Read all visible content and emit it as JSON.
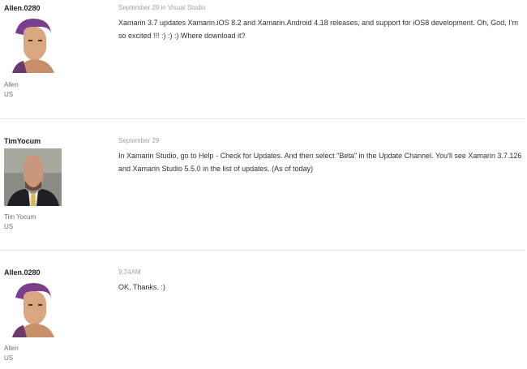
{
  "posts": [
    {
      "username": "Allen.0280",
      "display_name": "Allen",
      "country": "US",
      "date": "September 29",
      "in_word": "in",
      "forum": "Visual Studio",
      "text": "Xamarin 3.7 updates Xamarin.iOS 8.2 and Xamarin.Android 4.18 releases, and support for iOS8 development. Oh, God, I'm so excited !!! :) :) :) Where download it?",
      "avatar_icon": "user-avatar-photo"
    },
    {
      "username": "TimYocum",
      "display_name": "Tim Yocum",
      "country": "US",
      "date": "September 29",
      "text": "In Xamarin Studio, go to Help - Check for Updates. And then select \"Beta\" in the Update Channel. You'll see Xamarin 3.7.126 and Xamarin Studio 5.5.0 in the list of updates. (As of today)",
      "avatar_icon": "user-avatar-photo"
    },
    {
      "username": "Allen.0280",
      "display_name": "Allen",
      "country": "US",
      "date": "9:24AM",
      "text": "OK, Thanks. :)",
      "avatar_icon": "user-avatar-photo"
    }
  ],
  "colors": {
    "divider": "#e2e2e2",
    "meta": "#a0a0a0",
    "text": "#333333"
  }
}
